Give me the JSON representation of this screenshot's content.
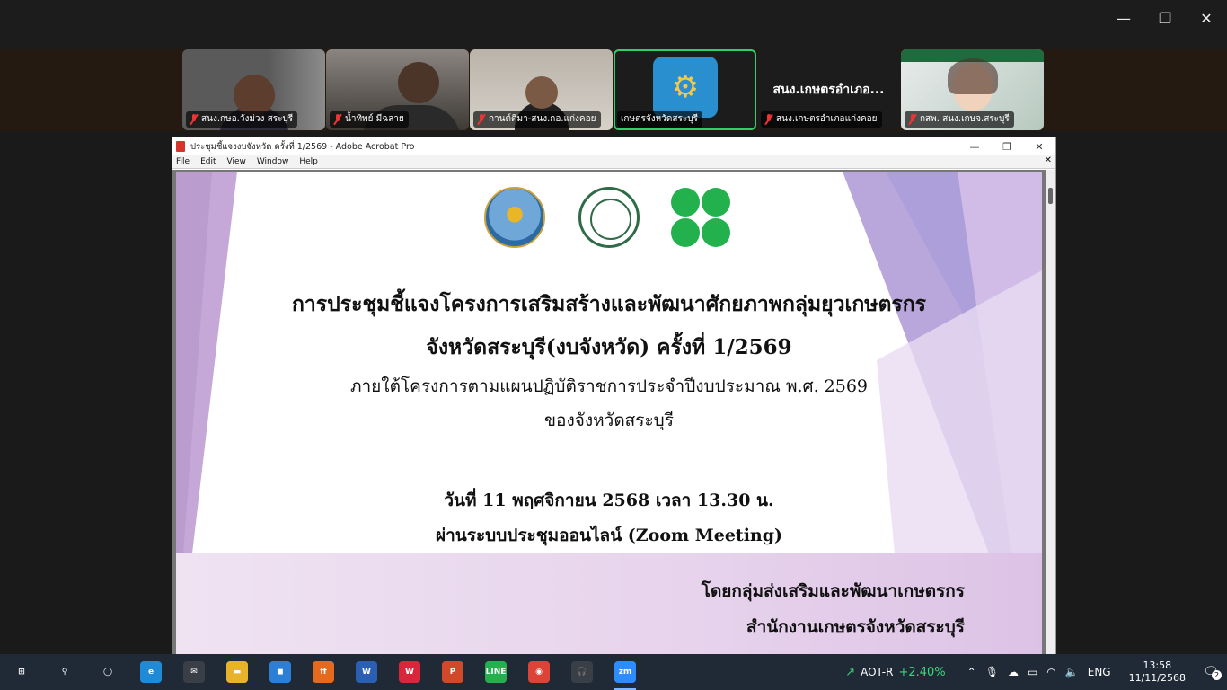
{
  "zoom": {
    "window_controls": {
      "minimize": "—",
      "restore": "❐",
      "close": "✕"
    },
    "participants": [
      {
        "name": "สนง.กษอ.วังม่วง สระบุรี",
        "muted": true,
        "big": ""
      },
      {
        "name": "น้ำทิพย์ มีฉลาย",
        "muted": true,
        "big": ""
      },
      {
        "name": "กานต์ติมา-สนง.กอ.แก่งคอย",
        "muted": true,
        "big": ""
      },
      {
        "name": "เกษตรจังหวัดสระบุรี",
        "muted": false,
        "big": "",
        "active": true
      },
      {
        "name": "สนง.เกษตรอำเภอแก่งคอย",
        "muted": true,
        "big": "สนง.เกษตรอำเภอ..."
      },
      {
        "name": "กสพ. สนง.เกษจ.สระบุรี",
        "muted": true,
        "big": ""
      }
    ]
  },
  "acrobat": {
    "title": "ประชุมชี้แจงงบจังหวัด ครั้งที่ 1/2569 - Adobe Acrobat Pro",
    "menu": [
      "File",
      "Edit",
      "View",
      "Window",
      "Help"
    ],
    "slide": {
      "line1": "การประชุมชี้แจงโครงการเสริมสร้างและพัฒนาศักยภาพกลุ่มยุวเกษตรกร",
      "line2": "จังหวัดสระบุรี(งบจังหวัด) ครั้งที่ 1/2569",
      "line3": "ภายใต้โครงการตามแผนปฏิบัติราชการประจำปีงบประมาณ พ.ศ. 2569",
      "line4": "ของจังหวัดสระบุรี",
      "line5": "วันที่ 11 พฤศจิกายน 2568 เวลา 13.30 น.",
      "line6": "ผ่านระบบประชุมออนไลน์ (Zoom Meeting)",
      "by1": "โดยกลุ่มส่งเสริมและพัฒนาเกษตรกร",
      "by2": "สำนักงานเกษตรจังหวัดสระบุรี"
    }
  },
  "taskbar": {
    "apps": [
      {
        "name": "start",
        "label": "⊞",
        "color": "#202a36"
      },
      {
        "name": "search",
        "label": "⚲",
        "color": "#202a36"
      },
      {
        "name": "task-view",
        "label": "◯",
        "color": "#202a36"
      },
      {
        "name": "edge",
        "label": "e",
        "color": "#1f8ad6"
      },
      {
        "name": "mail",
        "label": "✉",
        "color": "#3a3f47"
      },
      {
        "name": "file-explorer",
        "label": "▬",
        "color": "#e8b32a"
      },
      {
        "name": "store",
        "label": "◼",
        "color": "#2d7fd6"
      },
      {
        "name": "firefox",
        "label": "ff",
        "color": "#e56a1e"
      },
      {
        "name": "word",
        "label": "W",
        "color": "#2b5fb4"
      },
      {
        "name": "wps",
        "label": "W",
        "color": "#d9263a"
      },
      {
        "name": "powerpoint",
        "label": "P",
        "color": "#d2492a"
      },
      {
        "name": "line",
        "label": "LINE",
        "color": "#22b14c"
      },
      {
        "name": "chrome",
        "label": "◉",
        "color": "#db4437"
      },
      {
        "name": "headset",
        "label": "🎧",
        "color": "#3a3f47"
      },
      {
        "name": "zoom",
        "label": "zm",
        "color": "#2d8cff",
        "active": true
      }
    ],
    "stock_name": "AOT-R",
    "stock_change": "+2.40%",
    "language": "ENG",
    "time": "13:58",
    "date": "11/11/2568",
    "notifications": "2",
    "colors": {
      "stock_up": "#39d67a"
    }
  }
}
